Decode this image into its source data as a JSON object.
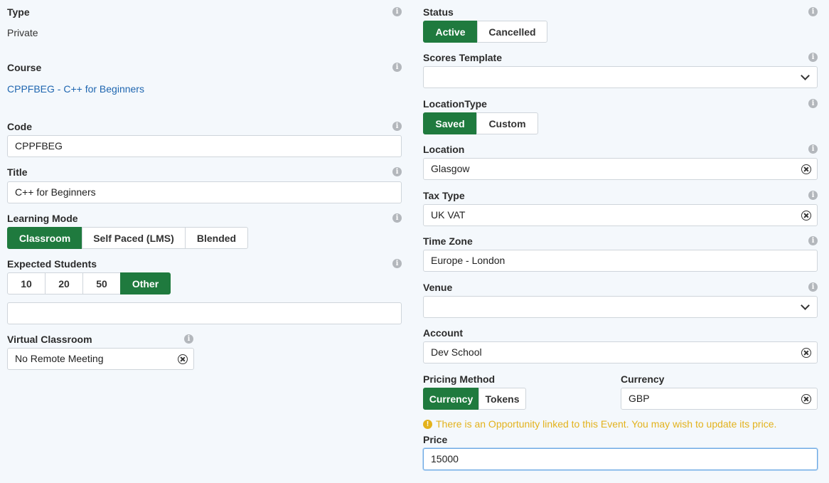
{
  "left": {
    "type": {
      "label": "Type",
      "value": "Private"
    },
    "course": {
      "label": "Course",
      "value": "CPPFBEG - C++ for Beginners"
    },
    "code": {
      "label": "Code",
      "value": "CPPFBEG"
    },
    "title": {
      "label": "Title",
      "value": "C++ for Beginners"
    },
    "learning_mode": {
      "label": "Learning Mode",
      "options": [
        "Classroom",
        "Self Paced (LMS)",
        "Blended"
      ],
      "selected": "Classroom"
    },
    "expected_students": {
      "label": "Expected Students",
      "options": [
        "10",
        "20",
        "50",
        "Other"
      ],
      "selected": "Other",
      "other_value": ""
    },
    "virtual_classroom": {
      "label": "Virtual Classroom",
      "value": "No Remote Meeting"
    }
  },
  "right": {
    "status": {
      "label": "Status",
      "options": [
        "Active",
        "Cancelled"
      ],
      "selected": "Active"
    },
    "scores_template": {
      "label": "Scores Template",
      "value": ""
    },
    "location_type": {
      "label": "LocationType",
      "options": [
        "Saved",
        "Custom"
      ],
      "selected": "Saved"
    },
    "location": {
      "label": "Location",
      "value": "Glasgow"
    },
    "tax_type": {
      "label": "Tax Type",
      "value": "UK VAT"
    },
    "time_zone": {
      "label": "Time Zone",
      "value": "Europe - London"
    },
    "venue": {
      "label": "Venue",
      "value": ""
    },
    "account": {
      "label": "Account",
      "value": "Dev School"
    },
    "pricing_method": {
      "label": "Pricing Method",
      "options": [
        "Currency",
        "Tokens"
      ],
      "selected": "Currency"
    },
    "currency": {
      "label": "Currency",
      "value": "GBP"
    },
    "warning": "There is an Opportunity linked to this Event. You may wish to update its price.",
    "price": {
      "label": "Price",
      "value": "15000"
    }
  },
  "icons": {
    "info": "info-icon",
    "clear": "clear-circle-x-icon",
    "dropdown": "chevron-down-icon",
    "warning": "exclamation-circle-icon"
  },
  "colors": {
    "active_green": "#1f7a3e",
    "link_blue": "#1f66b0",
    "warning_yellow": "#e3b21c",
    "background": "#f4f8fc"
  }
}
